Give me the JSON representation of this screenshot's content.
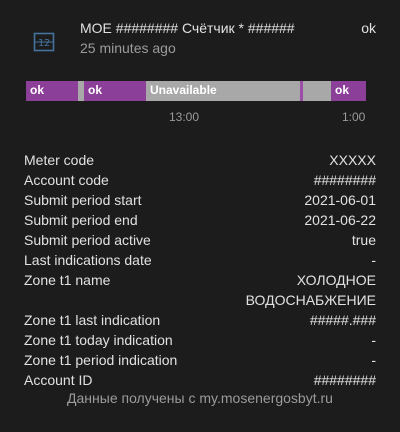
{
  "header": {
    "title": "MOE ######## Счётчик * ######",
    "subtitle": "25 minutes ago",
    "state": "ok",
    "icon": "counter-icon",
    "icon_color": "#44739e"
  },
  "timeline": {
    "segments": [
      {
        "label": "ok",
        "kind": "ok"
      },
      {
        "label": "",
        "kind": "unavail"
      },
      {
        "label": "ok",
        "kind": "ok"
      },
      {
        "label": "Unavailable",
        "kind": "unavail"
      },
      {
        "label": "",
        "kind": "thin"
      },
      {
        "label": "",
        "kind": "unavail"
      },
      {
        "label": "ok",
        "kind": "ok"
      }
    ],
    "ticks": [
      "13:00",
      "1:00"
    ],
    "colors": {
      "ok": "#8c3f98",
      "unavailable": "#a8a8a8"
    }
  },
  "attributes": [
    {
      "key": "Meter code",
      "value": "XXXXX"
    },
    {
      "key": "Account code",
      "value": "########"
    },
    {
      "key": "Submit period start",
      "value": "2021-06-01"
    },
    {
      "key": "Submit period end",
      "value": "2021-06-22"
    },
    {
      "key": "Submit period active",
      "value": "true"
    },
    {
      "key": "Last indications date",
      "value": "-"
    },
    {
      "key": "Zone t1 name",
      "value": "ХОЛОДНОЕ ВОДОСНАБЖЕНИЕ"
    },
    {
      "key": "Zone t1 last indication",
      "value": "#####.###"
    },
    {
      "key": "Zone t1 today indication",
      "value": "-"
    },
    {
      "key": "Zone t1 period indication",
      "value": "-"
    },
    {
      "key": "Account ID",
      "value": "########"
    }
  ],
  "footer": "Данные получены с my.mosenergosbyt.ru"
}
